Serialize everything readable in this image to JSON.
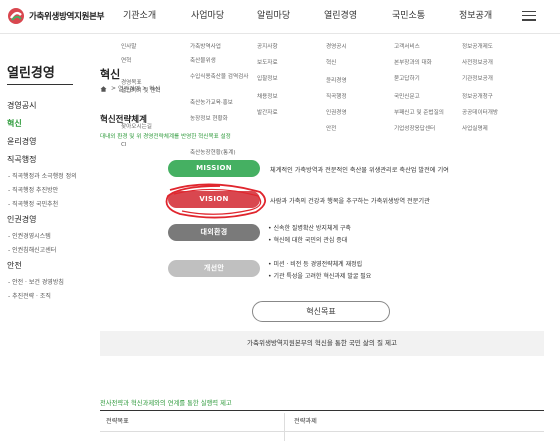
{
  "header": {
    "logo_text": "가축위생방역지원본부",
    "nav": [
      "기관소개",
      "사업마당",
      "알림마당",
      "열린경영",
      "국민소통",
      "정보공개"
    ]
  },
  "mega_menu": [
    [
      "인사말",
      "연혁",
      "경영목표",
      "설립목적 및 연혁",
      "찾아오시는길",
      "CI"
    ],
    [
      "가축방역사업",
      "축산물위생",
      "수입식용축산물 검역검사",
      "축산농가교육·홍보",
      "농장정보 현황화",
      "축산농장현황(통계)"
    ],
    [
      "공지사항",
      "보도자료",
      "입찰정보",
      "채용정보",
      "발간자료"
    ],
    [
      "경영공시",
      "혁신",
      "윤리경영",
      "직곡행정",
      "인권경영",
      "안전"
    ],
    [
      "고객서비스",
      "본부장과의 대화",
      "묻고답하기",
      "국민신문고",
      "부패신고 및 준법질의",
      "기업성장응답센터"
    ],
    [
      "정보공개제도",
      "사전정보공개",
      "기관정보공개",
      "정보공개청구",
      "공공데이터개방",
      "사업실명제"
    ]
  ],
  "sidebar": {
    "title": "열린경영",
    "items": [
      {
        "label": "경영공시",
        "active": false
      },
      {
        "label": "혁신",
        "active": true
      },
      {
        "label": "윤리경영",
        "active": false
      },
      {
        "label": "직곡행정",
        "active": false
      }
    ],
    "sub1": [
      "- 직곡행정과 소극행정 정의",
      "- 직곡행정 추진방안",
      "- 직곡행정 국민추천"
    ],
    "items2": [
      {
        "label": "인권경영"
      }
    ],
    "sub2": [
      "- 인권경영시스템",
      "- 인권침해신고센터"
    ],
    "items3": [
      {
        "label": "안전"
      }
    ],
    "sub3": [
      "- 안전 · 보건 경영방침",
      "- 추진전략 · 조직"
    ]
  },
  "content": {
    "page_title": "혁신",
    "breadcrumb": [
      "열린경영",
      "혁신"
    ],
    "section_title": "혁신전략체계",
    "slogan": "대내외 환경 및 위 경영전략체계를 반영한 혁신목표 설정",
    "mission_label": "MISSION",
    "mission_desc": "체계적인 가축방역과 전문적인 축산물 위생관리로 축산업 발전에 기여",
    "vision_label": "VISION",
    "vision_desc": "사람과 가축의 건강과 행복을 추구하는 가축위생방역 전문기관",
    "env_label": "대외환경",
    "env_bullets": [
      "• 신속한 질병확산 방지체계 구축",
      "• 혁신에 대한 국민의 관심 증대"
    ],
    "improve_label": "개선안",
    "improve_bullets": [
      "• 미션 · 비전 등 경영전략체계 재정립",
      "• 기관 특성을 고려한 혁신과제 발굴 필요"
    ],
    "innovate_button": "혁신목표",
    "goal_text": "가축위생방역지원본부의 혁신을 통한 국민 삶의 질 제고",
    "strategy_title": "전사전략과 혁신과제와의 연계를 통한 실행력 제고",
    "table_headers": [
      "전략목표",
      "전략과제"
    ]
  },
  "colors": {
    "green": "#45b062",
    "red": "#d9474f",
    "gray": "#7a7a7a",
    "light_gray": "#c0c0c0",
    "accent_text": "#2e9a3b"
  }
}
